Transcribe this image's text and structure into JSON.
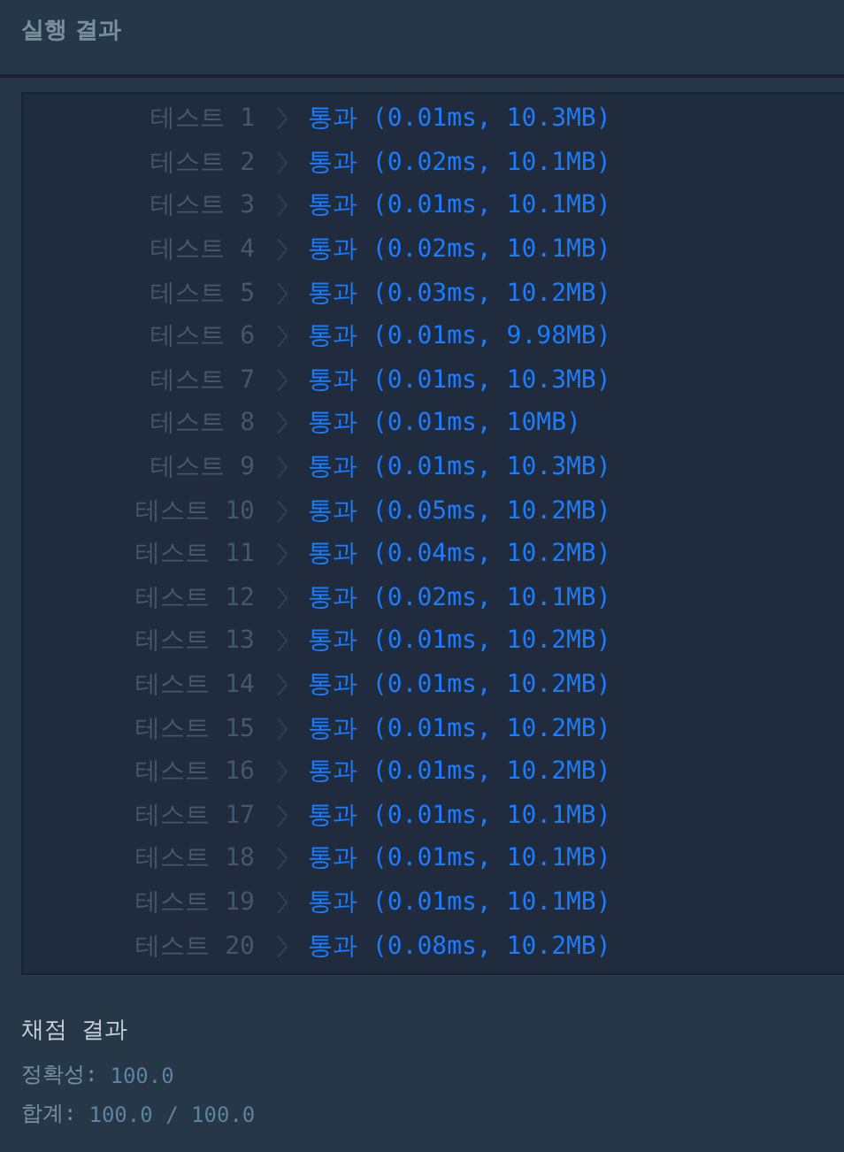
{
  "header": {
    "title": "실행 결과"
  },
  "tests": [
    {
      "label": "테스트 1",
      "result": "통과 (0.01ms, 10.3MB)"
    },
    {
      "label": "테스트 2",
      "result": "통과 (0.02ms, 10.1MB)"
    },
    {
      "label": "테스트 3",
      "result": "통과 (0.01ms, 10.1MB)"
    },
    {
      "label": "테스트 4",
      "result": "통과 (0.02ms, 10.1MB)"
    },
    {
      "label": "테스트 5",
      "result": "통과 (0.03ms, 10.2MB)"
    },
    {
      "label": "테스트 6",
      "result": "통과 (0.01ms, 9.98MB)"
    },
    {
      "label": "테스트 7",
      "result": "통과 (0.01ms, 10.3MB)"
    },
    {
      "label": "테스트 8",
      "result": "통과 (0.01ms, 10MB)"
    },
    {
      "label": "테스트 9",
      "result": "통과 (0.01ms, 10.3MB)"
    },
    {
      "label": "테스트 10",
      "result": "통과 (0.05ms, 10.2MB)"
    },
    {
      "label": "테스트 11",
      "result": "통과 (0.04ms, 10.2MB)"
    },
    {
      "label": "테스트 12",
      "result": "통과 (0.02ms, 10.1MB)"
    },
    {
      "label": "테스트 13",
      "result": "통과 (0.01ms, 10.2MB)"
    },
    {
      "label": "테스트 14",
      "result": "통과 (0.01ms, 10.2MB)"
    },
    {
      "label": "테스트 15",
      "result": "통과 (0.01ms, 10.2MB)"
    },
    {
      "label": "테스트 16",
      "result": "통과 (0.01ms, 10.2MB)"
    },
    {
      "label": "테스트 17",
      "result": "통과 (0.01ms, 10.1MB)"
    },
    {
      "label": "테스트 18",
      "result": "통과 (0.01ms, 10.1MB)"
    },
    {
      "label": "테스트 19",
      "result": "통과 (0.01ms, 10.1MB)"
    },
    {
      "label": "테스트 20",
      "result": "통과 (0.08ms, 10.2MB)"
    }
  ],
  "grading": {
    "title": "채점 결과",
    "items": [
      {
        "label": "정확성:",
        "value": "100.0"
      },
      {
        "label": "합계:",
        "value": "100.0 / 100.0"
      }
    ]
  }
}
